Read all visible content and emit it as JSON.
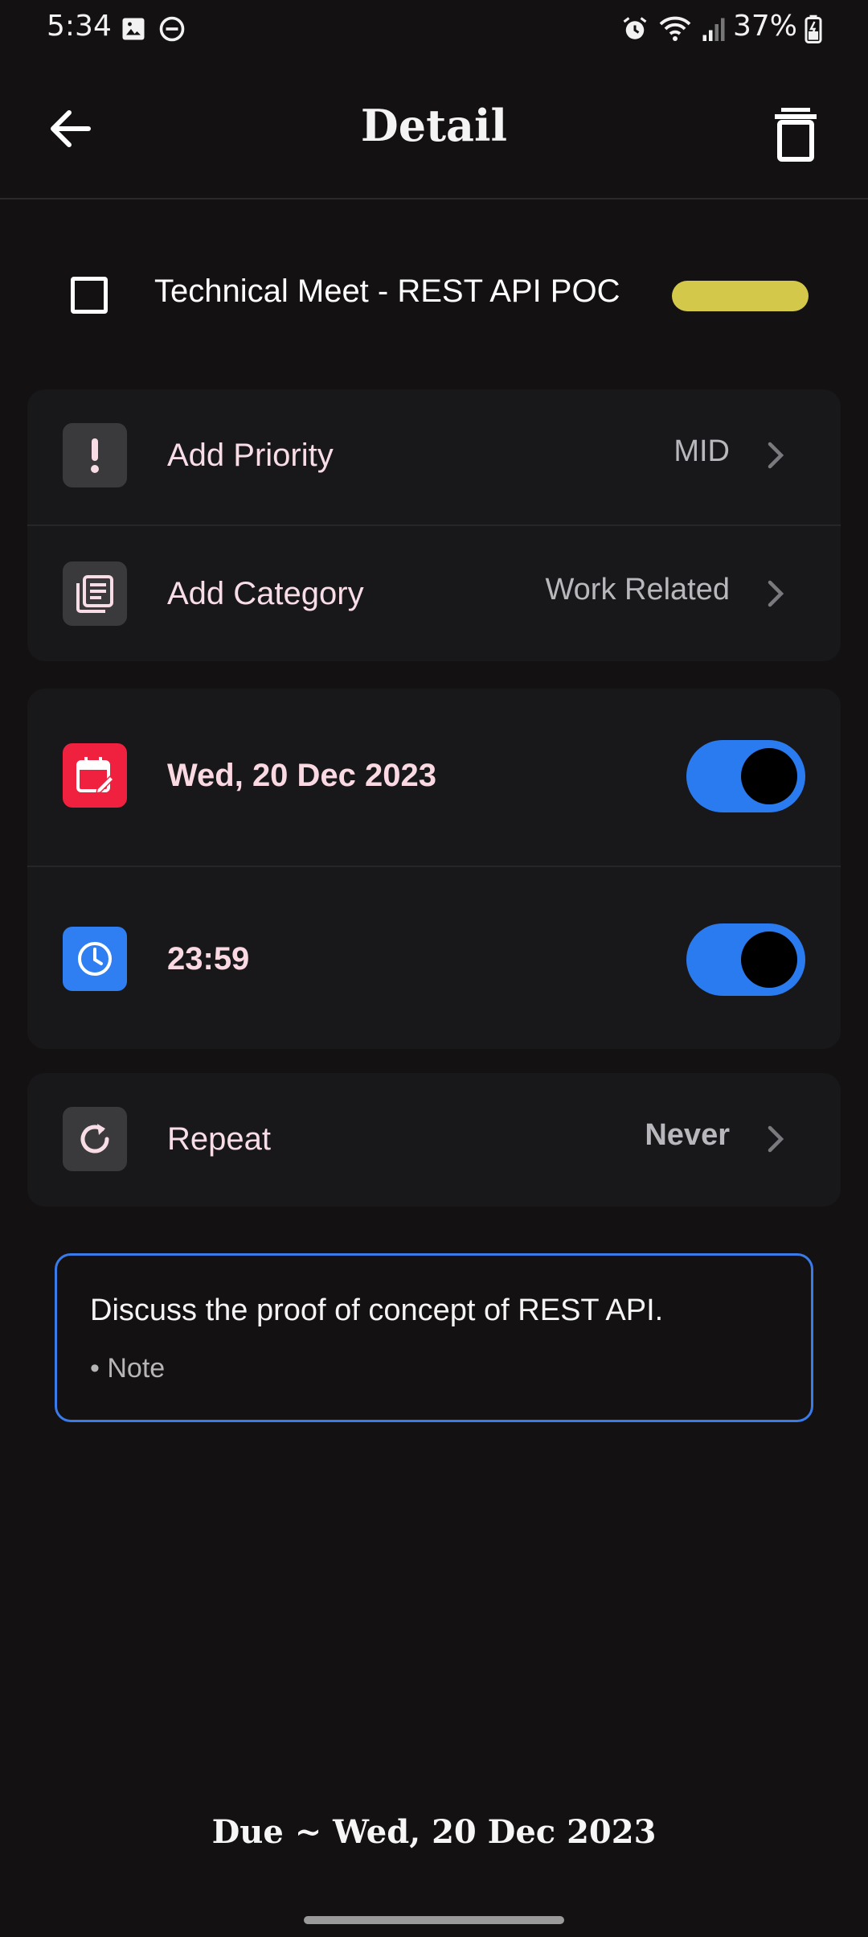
{
  "status_bar": {
    "time": "5:34",
    "battery": "37%",
    "icons": [
      "image-icon",
      "do-not-disturb-icon",
      "alarm-icon",
      "wifi-icon",
      "signal-icon",
      "battery-charging-icon"
    ]
  },
  "app_bar": {
    "title": "Detail",
    "back_icon": "arrow-left-icon",
    "delete_icon": "trash-icon"
  },
  "task": {
    "title": "Technical Meet - REST API POC",
    "checked": false,
    "tag_color": "#d4c84a"
  },
  "rows": {
    "priority": {
      "label": "Add Priority",
      "value": "MID",
      "icon": "exclamation-icon"
    },
    "category": {
      "label": "Add Category",
      "value": "Work Related",
      "icon": "list-icon"
    },
    "date": {
      "label": "Wed, 20 Dec 2023",
      "enabled": true,
      "icon": "calendar-edit-icon",
      "icon_color": "#f0213f"
    },
    "time": {
      "label": "23:59",
      "enabled": true,
      "icon": "clock-icon",
      "icon_color": "#2f7ff2"
    },
    "repeat": {
      "label": "Repeat",
      "value": "Never",
      "icon": "refresh-icon"
    }
  },
  "note": {
    "text": "Discuss the proof of concept of REST API.",
    "hint": "• Note"
  },
  "footer": {
    "due": "Due ~ Wed, 20 Dec 2023"
  },
  "colors": {
    "background": "#141113",
    "card": "#18181b",
    "accent_blue": "#2b7bf0",
    "label_pink": "#f8dde6"
  }
}
